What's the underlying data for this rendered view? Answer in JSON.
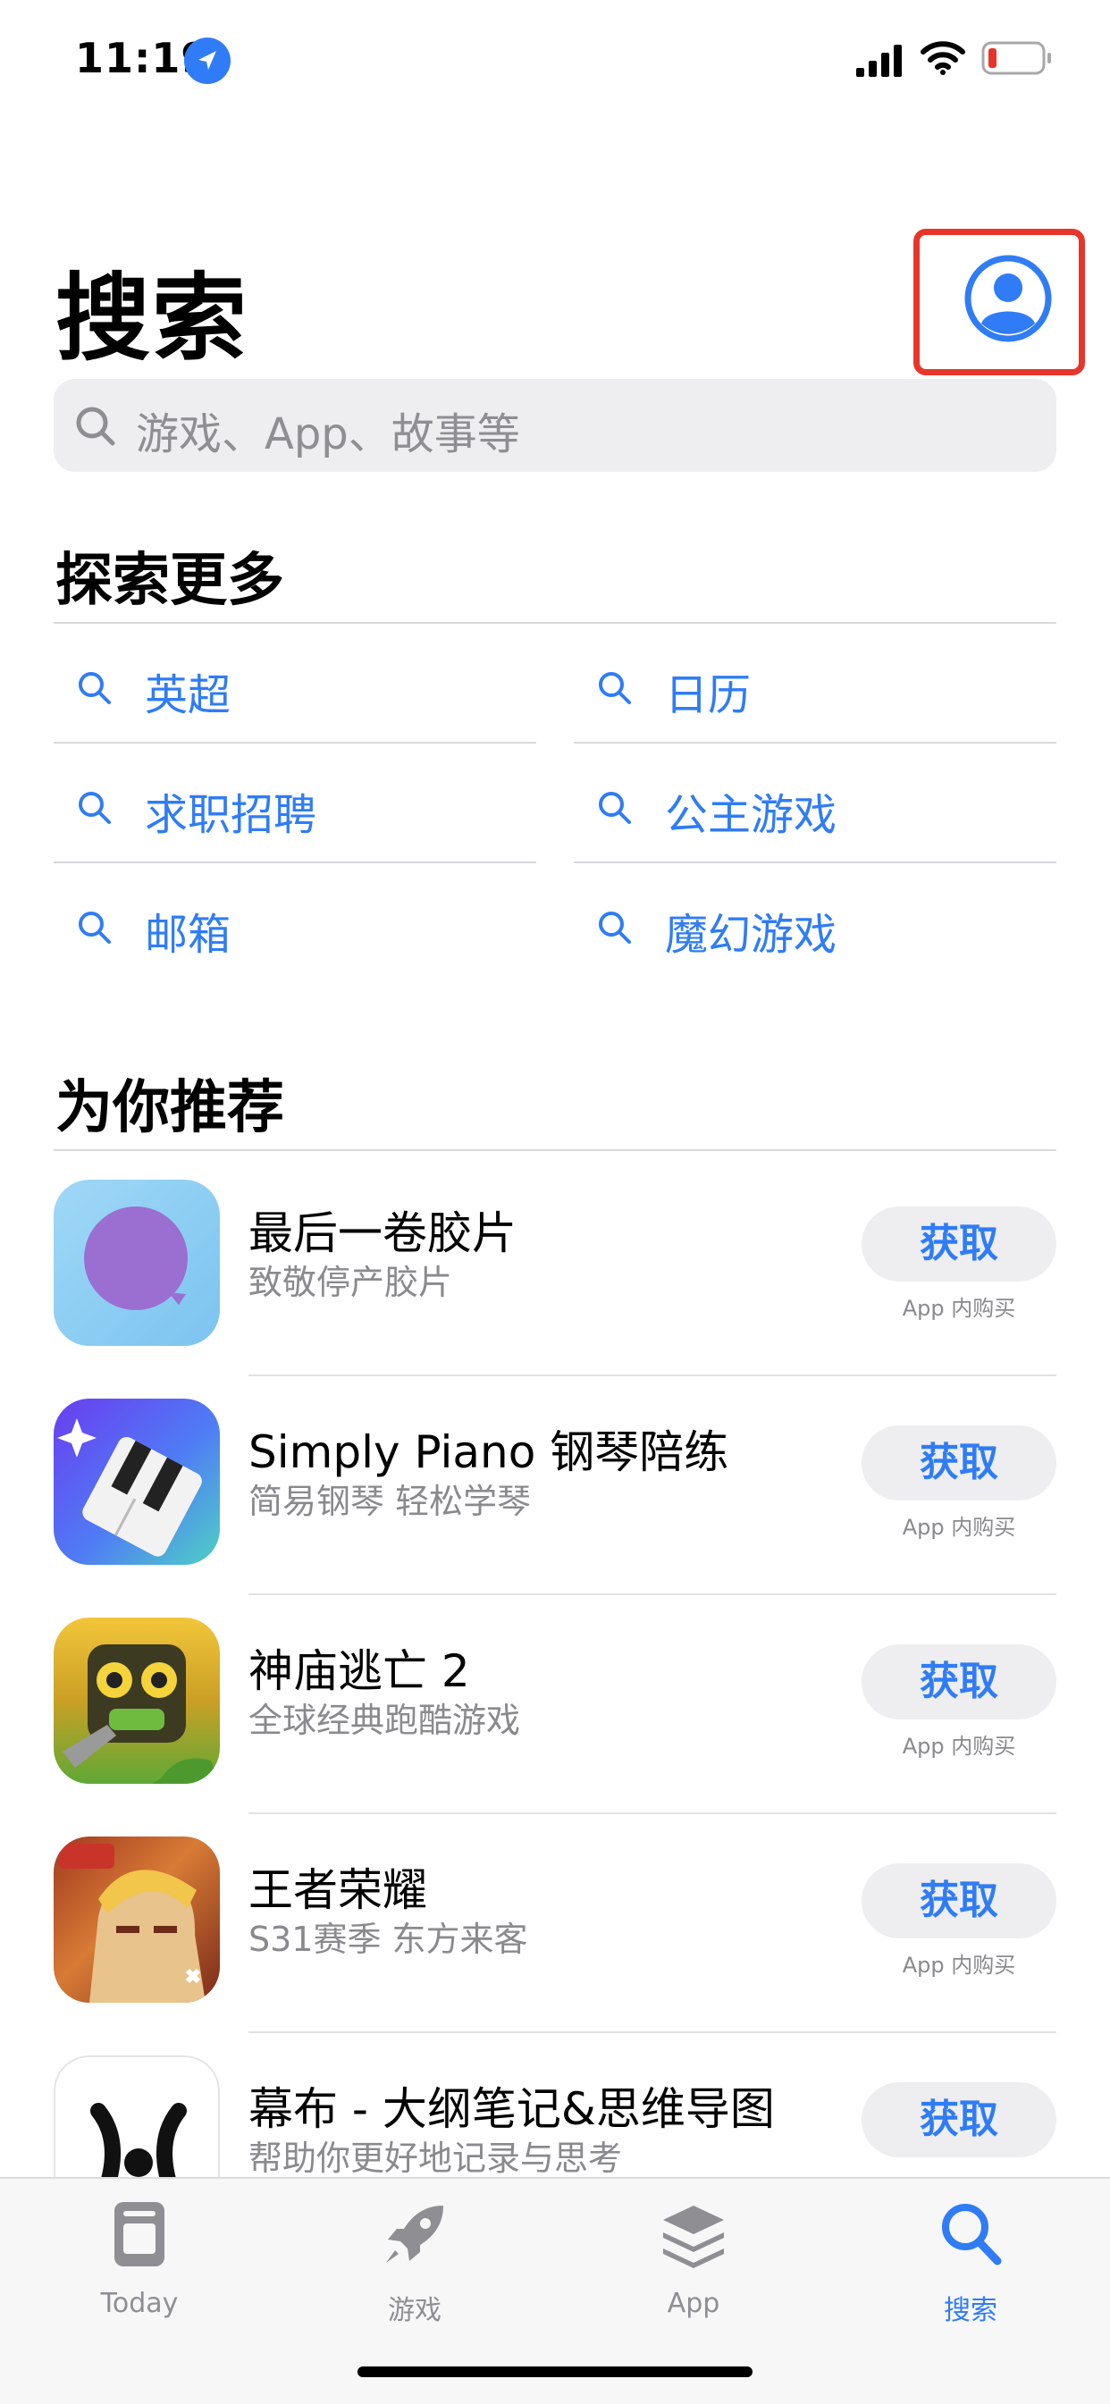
{
  "status_bar": {
    "time": "11:19"
  },
  "header": {
    "title": "搜索"
  },
  "search": {
    "placeholder": "游戏、App、故事等"
  },
  "explore": {
    "title": "探索更多",
    "items": [
      "英超",
      "日历",
      "求职招聘",
      "公主游戏",
      "邮箱",
      "魔幻游戏"
    ]
  },
  "recommend": {
    "title": "为你推荐",
    "apps": [
      {
        "name": "最后一卷胶片",
        "subtitle": "致敬停产胶片",
        "button": "获取",
        "iap": "App 内购买"
      },
      {
        "name": "Simply Piano 钢琴陪练",
        "subtitle": "简易钢琴 轻松学琴",
        "button": "获取",
        "iap": "App 内购买"
      },
      {
        "name": "神庙逃亡 2",
        "subtitle": "全球经典跑酷游戏",
        "button": "获取",
        "iap": "App 内购买"
      },
      {
        "name": "王者荣耀",
        "subtitle": "S31赛季 东方来客",
        "button": "获取",
        "iap": "App 内购买"
      },
      {
        "name": "幕布 - 大纲笔记&思维导图",
        "subtitle": "帮助你更好地记录与思考",
        "button": "获取",
        "iap": ""
      }
    ]
  },
  "tabbar": {
    "tabs": [
      {
        "label": "Today"
      },
      {
        "label": "游戏"
      },
      {
        "label": "App"
      },
      {
        "label": "搜索"
      }
    ]
  },
  "colors": {
    "accent": "#2f7cf6",
    "highlight": "#e8352a"
  }
}
